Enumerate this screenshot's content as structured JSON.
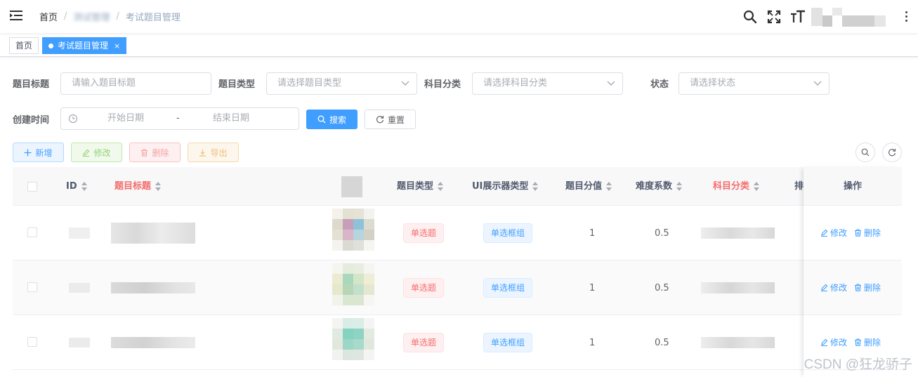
{
  "navbar": {
    "breadcrumb": {
      "home": "首页",
      "middle": "测试管理",
      "current": "考试题目管理"
    },
    "separator": "/"
  },
  "tags": {
    "home": "首页",
    "active": "考试题目管理",
    "close": "×"
  },
  "search": {
    "title_label": "题目标题",
    "title_placeholder": "请输入题目标题",
    "type_label": "题目类型",
    "type_placeholder": "请选择题目类型",
    "subject_label": "科目分类",
    "subject_placeholder": "请选择科目分类",
    "status_label": "状态",
    "status_placeholder": "请选择状态",
    "date_label": "创建时间",
    "date_start": "开始日期",
    "date_sep": "-",
    "date_end": "结束日期",
    "search_btn": "搜索",
    "reset_btn": "重置"
  },
  "toolbar": {
    "add": "新增",
    "edit": "修改",
    "delete": "删除",
    "export": "导出"
  },
  "table": {
    "columns": {
      "id": "ID",
      "title": "题目标题",
      "type": "题目类型",
      "ui_type": "UI展示器类型",
      "score": "题目分值",
      "difficulty": "难度系数",
      "subject": "科目分类",
      "sort": "排",
      "action": "操作"
    },
    "rows": [
      {
        "type": "单选题",
        "ui_type": "单选框组",
        "score": "1",
        "difficulty": "0.5",
        "edit": "修改",
        "delete": "删除"
      },
      {
        "type": "单选题",
        "ui_type": "单选框组",
        "score": "1",
        "difficulty": "0.5",
        "edit": "修改",
        "delete": "删除"
      },
      {
        "type": "单选题",
        "ui_type": "单选框组",
        "score": "1",
        "difficulty": "0.5",
        "edit": "修改",
        "delete": "删除"
      }
    ]
  },
  "watermark": "CSDN @狂龙骄子",
  "colors": {
    "primary": "#409eff",
    "danger": "#f56c6c",
    "success": "#67c23a",
    "warning": "#e6a23c"
  }
}
